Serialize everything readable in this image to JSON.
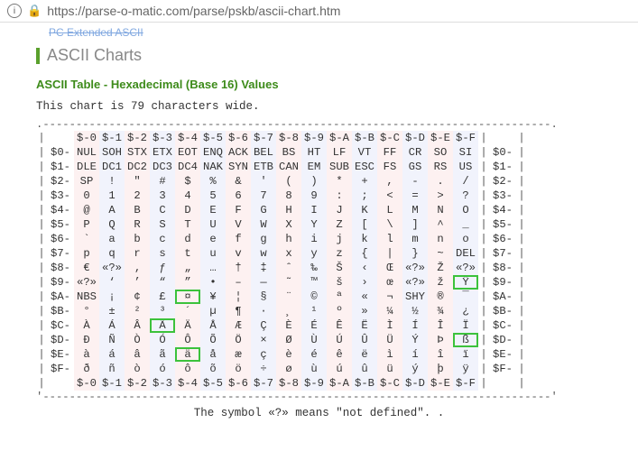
{
  "browser": {
    "url": "https://parse-o-matic.com/parse/pskb/ascii-chart.htm"
  },
  "nav": {
    "crumb": "PC Extended ASCII"
  },
  "headings": {
    "section": "ASCII Charts",
    "sub": "ASCII Table - Hexadecimal (Base 16) Values"
  },
  "notes": {
    "width": "This chart is 79 characters wide.",
    "footnote": "The symbol «?» means \"not defined\". ."
  },
  "chart_data": {
    "type": "table",
    "title": "ASCII Table - Hexadecimal (Base 16) Values",
    "undefined_marker": "«?»",
    "col_headers": [
      "$-0",
      "$-1",
      "$-2",
      "$-3",
      "$-4",
      "$-5",
      "$-6",
      "$-7",
      "$-8",
      "$-9",
      "$-A",
      "$-B",
      "$-C",
      "$-D",
      "$-E",
      "$-F"
    ],
    "row_headers": [
      "$0-",
      "$1-",
      "$2-",
      "$3-",
      "$4-",
      "$5-",
      "$6-",
      "$7-",
      "$8-",
      "$9-",
      "$A-",
      "$B-",
      "$C-",
      "$D-",
      "$E-",
      "$F-"
    ],
    "highlighted": [
      "A4",
      "9F",
      "C3",
      "E4",
      "DF"
    ],
    "rows": [
      [
        "NUL",
        "SOH",
        "STX",
        "ETX",
        "EOT",
        "ENQ",
        "ACK",
        "BEL",
        "BS",
        "HT",
        "LF",
        "VT",
        "FF",
        "CR",
        "SO",
        "SI"
      ],
      [
        "DLE",
        "DC1",
        "DC2",
        "DC3",
        "DC4",
        "NAK",
        "SYN",
        "ETB",
        "CAN",
        "EM",
        "SUB",
        "ESC",
        "FS",
        "GS",
        "RS",
        "US"
      ],
      [
        "SP",
        "!",
        "\"",
        "#",
        "$",
        "%",
        "&",
        "'",
        "(",
        ")",
        "*",
        "+",
        ",",
        "-",
        ".",
        "/"
      ],
      [
        "0",
        "1",
        "2",
        "3",
        "4",
        "5",
        "6",
        "7",
        "8",
        "9",
        ":",
        ";",
        "<",
        "=",
        ">",
        "?"
      ],
      [
        "@",
        "A",
        "B",
        "C",
        "D",
        "E",
        "F",
        "G",
        "H",
        "I",
        "J",
        "K",
        "L",
        "M",
        "N",
        "O"
      ],
      [
        "P",
        "Q",
        "R",
        "S",
        "T",
        "U",
        "V",
        "W",
        "X",
        "Y",
        "Z",
        "[",
        "\\",
        "]",
        "^",
        "_"
      ],
      [
        "`",
        "a",
        "b",
        "c",
        "d",
        "e",
        "f",
        "g",
        "h",
        "i",
        "j",
        "k",
        "l",
        "m",
        "n",
        "o"
      ],
      [
        "p",
        "q",
        "r",
        "s",
        "t",
        "u",
        "v",
        "w",
        "x",
        "y",
        "z",
        "{",
        "|",
        "}",
        "~",
        "DEL"
      ],
      [
        "€",
        "«?»",
        "‚",
        "ƒ",
        "„",
        "…",
        "†",
        "‡",
        "ˆ",
        "‰",
        "Š",
        "‹",
        "Œ",
        "«?»",
        "Ž",
        "«?»"
      ],
      [
        "«?»",
        "‘",
        "’",
        "“",
        "”",
        "•",
        "–",
        "—",
        "˜",
        "™",
        "š",
        "›",
        "œ",
        "«?»",
        "ž",
        "Ÿ"
      ],
      [
        "NBS",
        "¡",
        "¢",
        "£",
        "¤",
        "¥",
        "¦",
        "§",
        "¨",
        "©",
        "ª",
        "«",
        "¬",
        "SHY",
        "®",
        "¯"
      ],
      [
        "°",
        "±",
        "²",
        "³",
        "´",
        "µ",
        "¶",
        "·",
        "¸",
        "¹",
        "º",
        "»",
        "¼",
        "½",
        "¾",
        "¿"
      ],
      [
        "À",
        "Á",
        "Â",
        "Ã",
        "Ä",
        "Å",
        "Æ",
        "Ç",
        "È",
        "É",
        "Ê",
        "Ë",
        "Ì",
        "Í",
        "Î",
        "Ï"
      ],
      [
        "Ð",
        "Ñ",
        "Ò",
        "Ó",
        "Ô",
        "Õ",
        "Ö",
        "×",
        "Ø",
        "Ù",
        "Ú",
        "Û",
        "Ü",
        "Ý",
        "Þ",
        "ß"
      ],
      [
        "à",
        "á",
        "â",
        "ã",
        "ä",
        "å",
        "æ",
        "ç",
        "è",
        "é",
        "ê",
        "ë",
        "ì",
        "í",
        "î",
        "ï"
      ],
      [
        "ð",
        "ñ",
        "ò",
        "ó",
        "ô",
        "õ",
        "ö",
        "÷",
        "ø",
        "ù",
        "ú",
        "û",
        "ü",
        "ý",
        "þ",
        "ÿ"
      ]
    ]
  }
}
